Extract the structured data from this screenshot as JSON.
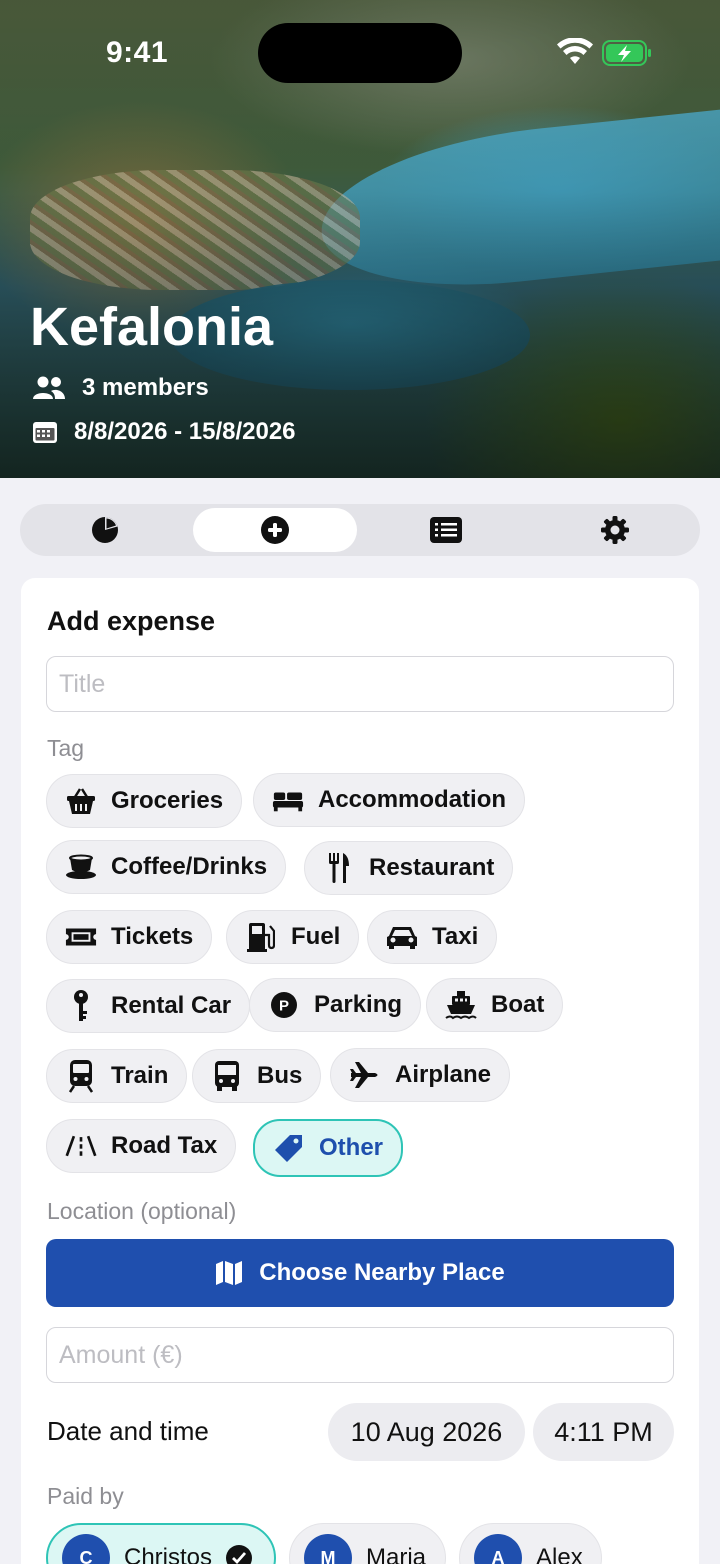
{
  "status_bar": {
    "time": "9:41"
  },
  "trip": {
    "name": "Kefalonia",
    "members": "3 members",
    "dates": "8/8/2026 - 15/8/2026"
  },
  "tabs": [
    {
      "icon": "pie-chart-icon"
    },
    {
      "icon": "add-circle-icon",
      "selected": true
    },
    {
      "icon": "list-icon"
    },
    {
      "icon": "gear-icon"
    }
  ],
  "form": {
    "heading": "Add expense",
    "title_placeholder": "Title",
    "tag_label": "Tag",
    "tags": [
      {
        "label": "Groceries",
        "icon": "basket-icon"
      },
      {
        "label": "Accommodation",
        "icon": "bed-icon"
      },
      {
        "label": "Coffee/Drinks",
        "icon": "coffee-icon"
      },
      {
        "label": "Restaurant",
        "icon": "utensils-icon"
      },
      {
        "label": "Tickets",
        "icon": "ticket-icon"
      },
      {
        "label": "Fuel",
        "icon": "fuel-pump-icon"
      },
      {
        "label": "Taxi",
        "icon": "car-icon"
      },
      {
        "label": "Rental Car",
        "icon": "key-icon"
      },
      {
        "label": "Parking",
        "icon": "parking-icon"
      },
      {
        "label": "Boat",
        "icon": "ship-icon"
      },
      {
        "label": "Train",
        "icon": "train-icon"
      },
      {
        "label": "Bus",
        "icon": "bus-icon"
      },
      {
        "label": "Airplane",
        "icon": "airplane-icon"
      },
      {
        "label": "Road Tax",
        "icon": "road-icon"
      },
      {
        "label": "Other",
        "icon": "tag-icon",
        "selected": true
      }
    ],
    "location_label": "Location (optional)",
    "nearby_button": "Choose Nearby Place",
    "amount_placeholder": "Amount (€)",
    "datetime_label": "Date and time",
    "date_value": "10 Aug 2026",
    "time_value": "4:11 PM",
    "paid_by_label": "Paid by",
    "payers": [
      {
        "initial": "C",
        "name": "Christos",
        "selected": true
      },
      {
        "initial": "M",
        "name": "Maria"
      },
      {
        "initial": "A",
        "name": "Alex"
      }
    ]
  },
  "colors": {
    "accent": "#1f4fae",
    "selected_bg": "#dcf7f4",
    "selected_border": "#2ec4b6",
    "battery_green": "#34c759"
  }
}
